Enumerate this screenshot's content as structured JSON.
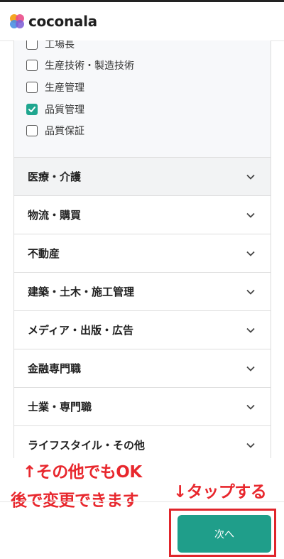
{
  "app": {
    "logo_text": "coconala"
  },
  "checklist": [
    {
      "label": "工場長",
      "checked": false
    },
    {
      "label": "生産技術・製造技術",
      "checked": false
    },
    {
      "label": "生産管理",
      "checked": false
    },
    {
      "label": "品質管理",
      "checked": true
    },
    {
      "label": "品質保証",
      "checked": false
    }
  ],
  "categories": [
    {
      "label": "医療・介護",
      "active": true
    },
    {
      "label": "物流・購買",
      "active": false
    },
    {
      "label": "不動産",
      "active": false
    },
    {
      "label": "建築・土木・施工管理",
      "active": false
    },
    {
      "label": "メディア・出版・広告",
      "active": false
    },
    {
      "label": "金融専門職",
      "active": false
    },
    {
      "label": "士業・専門職",
      "active": false
    },
    {
      "label": "ライフスタイル・その他",
      "active": false
    }
  ],
  "annotations": {
    "other_ok": "↑その他でもOK",
    "change_later": "後で変更できます",
    "tap": "↓タップする"
  },
  "footer": {
    "next_label": "次へ"
  },
  "colors": {
    "accent": "#1f9e8a",
    "annotation": "#e8272d"
  }
}
